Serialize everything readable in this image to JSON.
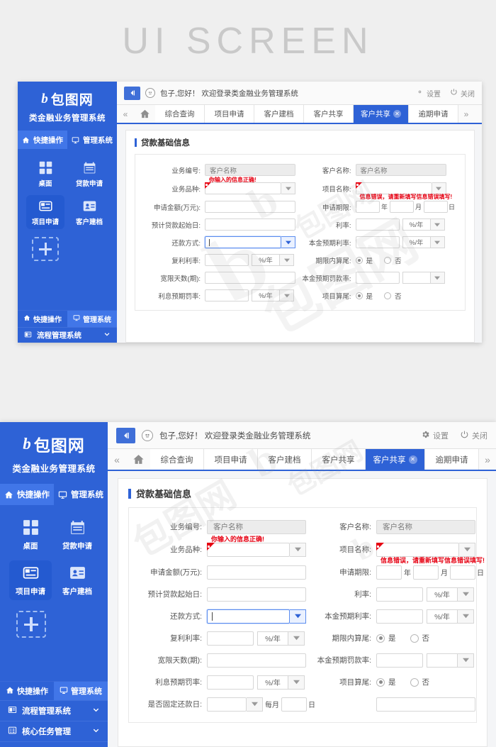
{
  "poster": {
    "title": "UI SCREEN"
  },
  "brand": {
    "mark": "b",
    "name": "包图网",
    "subtitle": "类金融业务管理系统"
  },
  "sidebar": {
    "top_switch": [
      {
        "label": "快捷操作",
        "icon": "home-icon",
        "active": true
      },
      {
        "label": "管理系统",
        "icon": "monitor-icon",
        "active": false
      }
    ],
    "quick_items": [
      {
        "label": "桌面",
        "icon": "grid-icon",
        "active": false
      },
      {
        "label": "贷款申请",
        "icon": "calendar-icon",
        "active": false
      },
      {
        "label": "项目申请",
        "icon": "card-icon",
        "active": true
      },
      {
        "label": "客户建档",
        "icon": "id-card-icon",
        "active": false
      }
    ],
    "add_tile": {
      "label": "+",
      "icon": "plus-icon"
    },
    "bottom_switch": [
      {
        "label": "快捷操作",
        "icon": "home-icon",
        "active": false
      },
      {
        "label": "管理系统",
        "icon": "monitor-icon",
        "active": true
      }
    ],
    "menu_items": [
      {
        "label": "流程管理系统",
        "icon": "window-icon",
        "chevron": "chevron-down-icon"
      },
      {
        "label": "核心任务管理",
        "icon": "list-icon",
        "chevron": "chevron-down-icon"
      }
    ]
  },
  "topbar": {
    "collapse_icon": "collapse-left-icon",
    "avatar_icon": "smiley-icon",
    "welcome": "包子,您好！ 欢迎登录类金融业务管理系统",
    "actions": [
      {
        "label": "设置",
        "icon": "gear-icon"
      },
      {
        "label": "关闭",
        "icon": "power-icon"
      }
    ]
  },
  "tabbar": {
    "prev_icon": "chevron-double-left-icon",
    "home_icon": "home-outline-icon",
    "next_icon": "chevron-double-right-icon",
    "tabs": [
      {
        "label": "综合查询",
        "active": false,
        "closable": false
      },
      {
        "label": "项目申请",
        "active": false,
        "closable": false
      },
      {
        "label": "客户建档",
        "active": false,
        "closable": false
      },
      {
        "label": "客户共享",
        "active": false,
        "closable": false
      },
      {
        "label": "客户共享",
        "active": true,
        "closable": true
      },
      {
        "label": "逾期申请",
        "active": false,
        "closable": false
      }
    ]
  },
  "form": {
    "section_title": "贷款基础信息",
    "messages": {
      "success": "你输入的信息正确!",
      "error": "信息错误，请重新填写信息错误填写!"
    },
    "units": {
      "percent_year": "%/年",
      "empty": ""
    },
    "left": [
      {
        "label": "业务编号:",
        "type": "readonly",
        "value": "客户名称"
      },
      {
        "label": "业务品种:",
        "type": "select",
        "value": "",
        "flag": true
      },
      {
        "label": "申请金额(万元):",
        "type": "text",
        "value": ""
      },
      {
        "label": "预计贷款起始日:",
        "type": "text",
        "value": ""
      },
      {
        "label": "还款方式:",
        "type": "select",
        "value": "",
        "focused": true
      },
      {
        "label": "复利利率:",
        "type": "text-unit",
        "value": "",
        "unit": "%/年"
      },
      {
        "label": "宽限天数(期):",
        "type": "text",
        "value": ""
      },
      {
        "label": "利息预期罚率:",
        "type": "text-unit",
        "value": "",
        "unit": "%/年"
      },
      {
        "label": "是否固定还款日:",
        "type": "select-suffix",
        "value": "",
        "mid_text": "每月",
        "suffix_text": "日"
      }
    ],
    "right": [
      {
        "label": "客户名称:",
        "type": "readonly",
        "value": "客户名称"
      },
      {
        "label": "项目名称:",
        "type": "select",
        "value": "",
        "flag": true
      },
      {
        "label": "申请期限:",
        "type": "ymd",
        "value": "",
        "y": "年",
        "m": "月",
        "d": "日"
      },
      {
        "label": "利率:",
        "type": "text-unit",
        "value": "",
        "unit": "%/年"
      },
      {
        "label": "本金预期利率:",
        "type": "text-unit",
        "value": "",
        "unit": "%/年"
      },
      {
        "label": "期限内算尾:",
        "type": "radio",
        "options": [
          "是",
          "否"
        ],
        "selected": 0
      },
      {
        "label": "本金预期罚款率:",
        "type": "text-unit",
        "value": "",
        "unit": ""
      },
      {
        "label": "项目算尾:",
        "type": "radio",
        "options": [
          "是",
          "否"
        ],
        "selected": 0
      },
      {
        "label": "",
        "type": "text",
        "value": ""
      }
    ]
  },
  "watermark": {
    "text": "包图网",
    "mark": "b"
  },
  "colors": {
    "brand_blue": "#2e62d6",
    "accent_blue": "#4176e8",
    "error_red": "#e60012",
    "page_bg": "#efefef",
    "panel_bg": "#f4f5f7"
  }
}
